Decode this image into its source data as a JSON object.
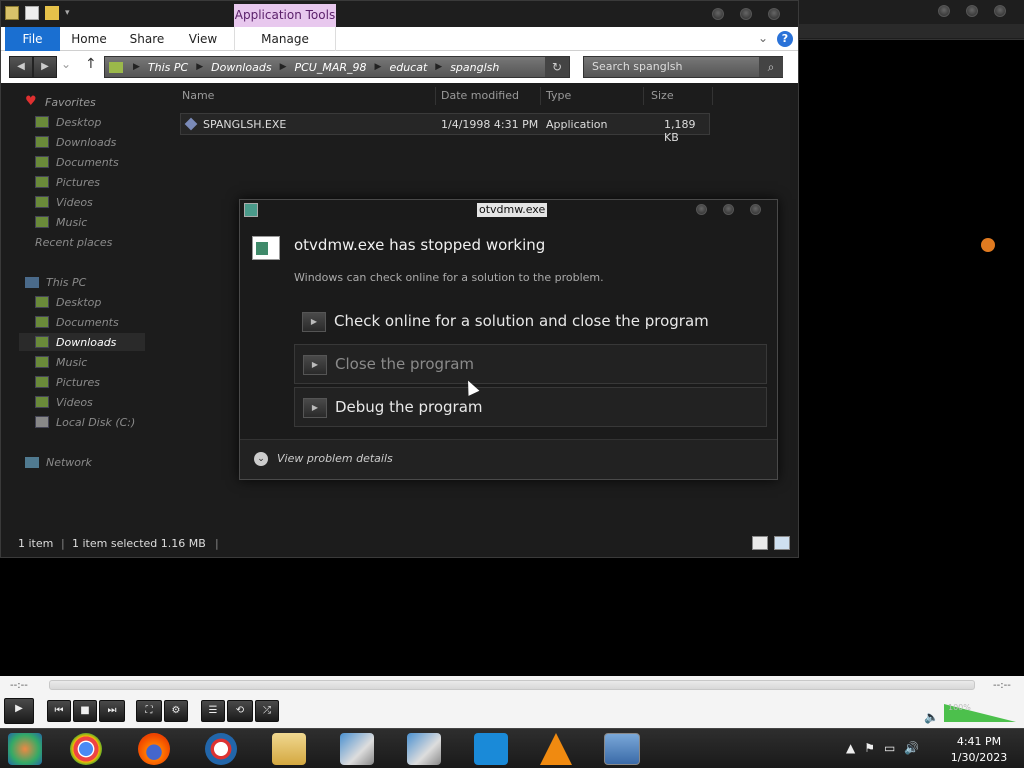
{
  "background_window": {},
  "explorer": {
    "contextual_tab": "Application Tools",
    "tabs": [
      "File",
      "Home",
      "Share",
      "View",
      "Manage"
    ],
    "help_glyph": "?",
    "address": [
      "This PC",
      "Downloads",
      "PCU_MAR_98",
      "educat",
      "spanglsh"
    ],
    "search_placeholder": "Search spanglsh",
    "nav": {
      "favorites": "Favorites",
      "fav_items": [
        "Desktop",
        "Downloads",
        "Documents",
        "Pictures",
        "Videos",
        "Music",
        "Recent places"
      ],
      "thispc": "This PC",
      "pc_items": [
        "Desktop",
        "Documents",
        "Downloads",
        "Music",
        "Pictures",
        "Videos",
        "Local Disk (C:)"
      ],
      "network": "Network"
    },
    "columns": [
      "Name",
      "Date modified",
      "Type",
      "Size"
    ],
    "file": {
      "name": "SPANGLSH.EXE",
      "date": "1/4/1998 4:31 PM",
      "type": "Application",
      "size": "1,189 KB"
    },
    "status": {
      "items": "1 item",
      "selected": "1 item selected  1.16 MB"
    }
  },
  "dialog": {
    "title": "otvdmw.exe",
    "heading": "otvdmw.exe has stopped working",
    "subtext": "Windows can check online for a solution to the problem.",
    "options": [
      "Check online for a solution and close the program",
      "Close the program",
      "Debug the program"
    ],
    "details": "View problem details"
  },
  "player": {
    "time_left": "--:--",
    "time_right": "--:--",
    "volume_label": "100%",
    "volume_level": 1.0
  },
  "taskbar": {
    "time": "4:41 PM",
    "date": "1/30/2023",
    "apps": [
      "start-orb",
      "chrome",
      "firefox",
      "obama-logo",
      "file-explorer",
      "installer-1",
      "installer-2",
      "arrow-app",
      "vlc",
      "warning-app"
    ]
  },
  "colors": {
    "file_tab": "#1a6fd1",
    "apptools_bg": "#e8c8ee",
    "volume": "#4cc04c"
  }
}
